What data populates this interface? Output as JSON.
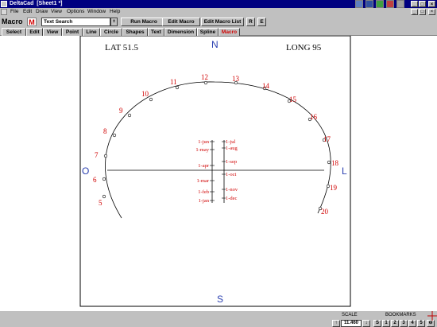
{
  "window": {
    "title": "DeltaCad  [Sheet1 *]",
    "controls": [
      "_",
      "□",
      "×"
    ],
    "accent": "#000080"
  },
  "menu": {
    "items": [
      "File",
      "Edit",
      "Draw",
      "View",
      "Options",
      "Window",
      "Help"
    ],
    "mdi_controls": [
      "_",
      "□",
      "×"
    ]
  },
  "macro_toolbar": {
    "label": "Macro",
    "macro_icon": "M",
    "search_value": "Text Search",
    "spin_glyph": "±",
    "run_label": "Run Macro",
    "edit_label": "Edit Macro",
    "edit_list_label": "Edit Macro List",
    "r_label": "R",
    "e_label": "E"
  },
  "tabs": [
    {
      "label": "Select",
      "active": false
    },
    {
      "label": "Edit",
      "active": false
    },
    {
      "label": "View",
      "active": false
    },
    {
      "label": "Point",
      "active": false
    },
    {
      "label": "Line",
      "active": false
    },
    {
      "label": "Circle",
      "active": false
    },
    {
      "label": "Shapes",
      "active": false
    },
    {
      "label": "Text",
      "active": false
    },
    {
      "label": "Dimension",
      "active": false
    },
    {
      "label": "Spline",
      "active": false
    },
    {
      "label": "Macro",
      "active": true
    }
  ],
  "drawing": {
    "lat_label": "LAT  51.5",
    "long_label": "LONG  95",
    "compass": {
      "north": "N",
      "south": "S",
      "west": "O",
      "east": "L"
    },
    "hour_labels": [
      "5",
      "6",
      "7",
      "8",
      "9",
      "10",
      "11",
      "12",
      "13",
      "14",
      "15",
      "16",
      "17",
      "18",
      "19",
      "20"
    ],
    "left_dates": [
      "1-jun",
      "1-may",
      "1-apr",
      "1-mar",
      "1-feb",
      "1-jan"
    ],
    "right_dates": [
      "1-jul",
      "1-aug",
      "1-sep",
      "1-oct",
      "1-nov",
      "1-dec"
    ],
    "red": "#d00000",
    "blue": "#2a3fb0"
  },
  "status": {
    "scale_label": "SCALE",
    "scale_value": "11.460",
    "scale_up": "↑",
    "scale_down": "↓",
    "bookmarks_label": "BOOKMARKS",
    "bookmark_buttons": [
      "S",
      "1",
      "2",
      "3",
      "4",
      "5"
    ],
    "menu_glyph": "⊖"
  }
}
